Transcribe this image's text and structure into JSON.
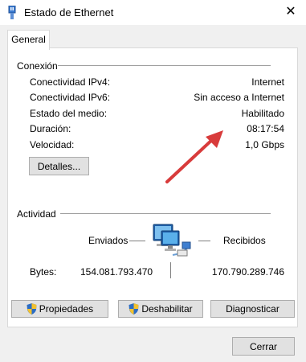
{
  "window": {
    "title": "Estado de Ethernet",
    "close_glyph": "✕"
  },
  "tabs": [
    {
      "label": "General"
    }
  ],
  "connection": {
    "group_label": "Conexión",
    "rows": [
      {
        "label": "Conectividad IPv4:",
        "value": "Internet"
      },
      {
        "label": "Conectividad IPv6:",
        "value": "Sin acceso a Internet"
      },
      {
        "label": "Estado del medio:",
        "value": "Habilitado"
      },
      {
        "label": "Duración:",
        "value": "08:17:54"
      },
      {
        "label": "Velocidad:",
        "value": "1,0 Gbps"
      }
    ],
    "details_button": "Detalles..."
  },
  "activity": {
    "group_label": "Actividad",
    "sent_label": "Enviados",
    "received_label": "Recibidos",
    "bytes_label": "Bytes:",
    "bytes_sent": "154.081.793.470",
    "bytes_received": "170.790.289.746",
    "network_icon": "network-computers-icon"
  },
  "buttons": {
    "properties": "Propiedades",
    "disable": "Deshabilitar",
    "diagnose": "Diagnosticar",
    "close": "Cerrar"
  },
  "colors": {
    "annotation_arrow": "#d83b3b",
    "shield_blue": "#2b6cc4",
    "shield_yellow": "#f2c12e"
  }
}
